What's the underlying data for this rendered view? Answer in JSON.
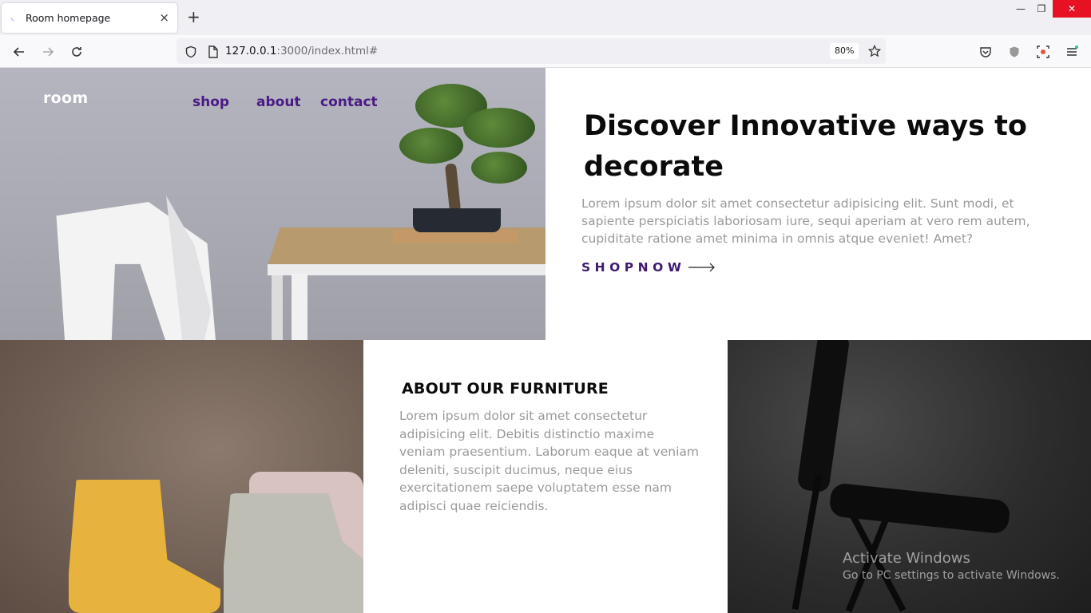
{
  "browser": {
    "tab_title": "Room homepage",
    "new_tab_label": "+",
    "tab_close_label": "×",
    "url_host": "127.0.0.1",
    "url_path": ":3000/index.html#",
    "zoom": "80%",
    "win_minimize": "—",
    "win_restore": "❐",
    "win_close": "✕"
  },
  "header": {
    "logo": "room",
    "nav": [
      {
        "label": "shop"
      },
      {
        "label": "about"
      },
      {
        "label": "contact"
      }
    ]
  },
  "hero": {
    "title": "Discover Innovative ways to decorate",
    "description": "Lorem ipsum dolor sit amet consectetur adipisicing elit. Sunt modi, et sapiente perspiciatis laboriosam iure, sequi aperiam at vero rem autem, cupiditate ratione amet minima in omnis atque eveniet! Amet?",
    "cta": "SHOPNOW"
  },
  "about": {
    "title": "ABOUT OUR FURNITURE",
    "description": "Lorem ipsum dolor sit amet consectetur adipisicing elit. Debitis distinctio maxime veniam praesentium. Laborum eaque at veniam deleniti, suscipit ducimus, neque eius exercitationem saepe voluptatem esse nam adipisci quae reiciendis."
  },
  "watermark": {
    "line1": "Activate Windows",
    "line2": "Go to PC settings to activate Windows."
  },
  "colors": {
    "accent": "#4a1a86",
    "muted_text": "#9a9a9a",
    "heading": "#0b0b0b"
  }
}
